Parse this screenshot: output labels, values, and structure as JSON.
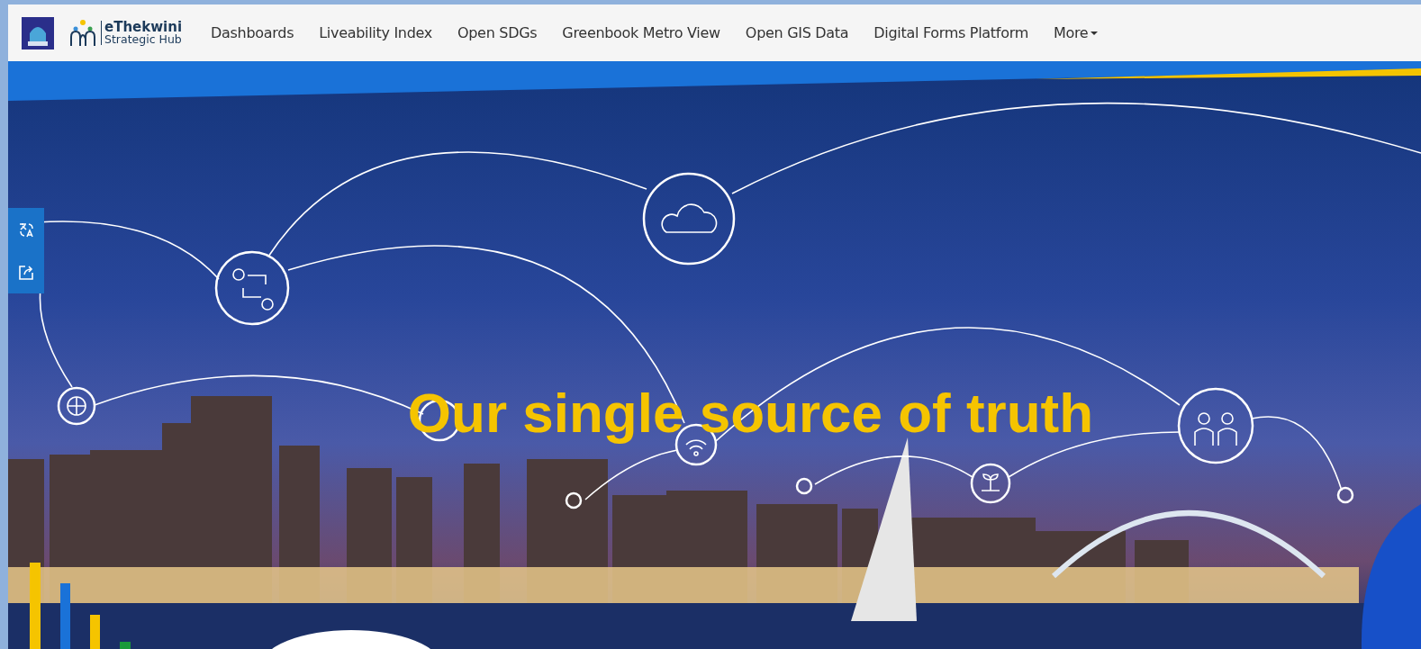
{
  "header": {
    "logo_title": "eThekwini",
    "logo_subtitle": "Strategic Hub",
    "nav": [
      {
        "label": "Dashboards",
        "kind": "link"
      },
      {
        "label": "Liveability Index",
        "kind": "link"
      },
      {
        "label": "Open SDGs",
        "kind": "link"
      },
      {
        "label": "Greenbook Metro View",
        "kind": "link"
      },
      {
        "label": "Open GIS Data",
        "kind": "link"
      },
      {
        "label": "Digital Forms Platform",
        "kind": "link"
      },
      {
        "label": "More",
        "kind": "dropdown"
      }
    ]
  },
  "hero": {
    "heading": "Our single source of truth"
  },
  "side_toolbar": [
    {
      "kind": "translate"
    },
    {
      "kind": "share"
    }
  ]
}
